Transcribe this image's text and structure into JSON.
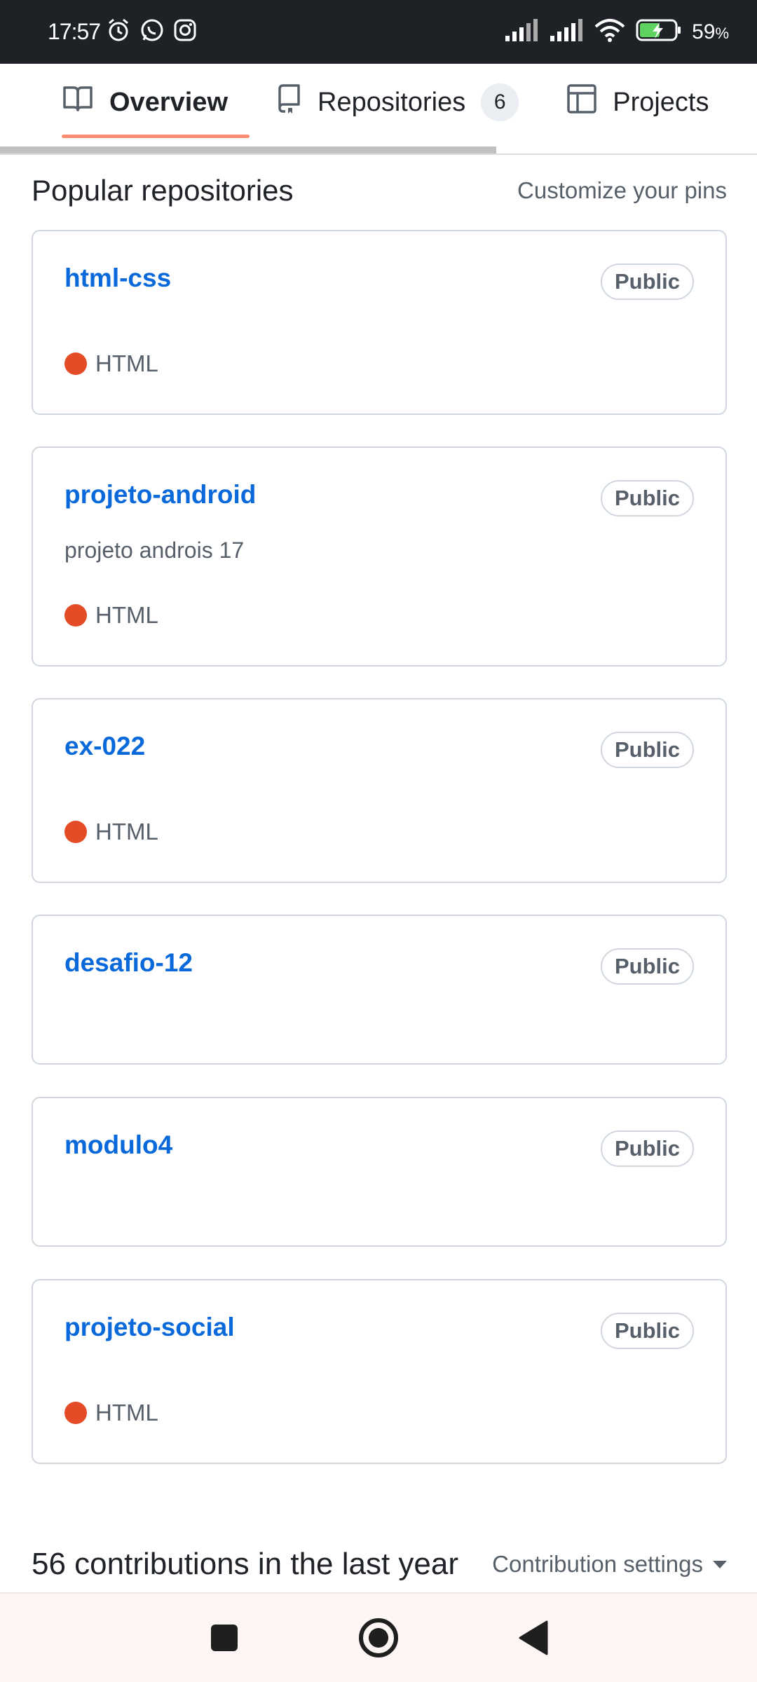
{
  "status_bar": {
    "time": "17:57",
    "battery": "59",
    "battery_unit": "%",
    "icons": [
      "alarm-icon",
      "whatsapp-icon",
      "instagram-icon",
      "signal-icon",
      "signal-icon",
      "wifi-icon",
      "battery-charging-icon"
    ]
  },
  "tabs": [
    {
      "label": "Overview",
      "icon": "book-icon",
      "active": true
    },
    {
      "label": "Repositories",
      "icon": "repo-icon",
      "count": "6"
    },
    {
      "label": "Projects",
      "icon": "table-icon"
    }
  ],
  "popular": {
    "title": "Popular repositories",
    "customize_link": "Customize your pins"
  },
  "repos": [
    {
      "name": "html-css",
      "visibility": "Public",
      "description": "",
      "language": "HTML"
    },
    {
      "name": "projeto-android",
      "visibility": "Public",
      "description": "projeto androis 17",
      "language": "HTML"
    },
    {
      "name": "ex-022",
      "visibility": "Public",
      "description": "",
      "language": "HTML"
    },
    {
      "name": "desafio-12",
      "visibility": "Public",
      "description": "",
      "language": ""
    },
    {
      "name": "modulo4",
      "visibility": "Public",
      "description": "",
      "language": ""
    },
    {
      "name": "projeto-social",
      "visibility": "Public",
      "description": "",
      "language": "HTML"
    }
  ],
  "language_color": "#e34c26",
  "accent_color": "#0969da",
  "contributions": {
    "title": "56 contributions in the last year",
    "settings_label": "Contribution settings"
  },
  "nav": [
    "recents-icon",
    "home-icon",
    "back-icon"
  ]
}
